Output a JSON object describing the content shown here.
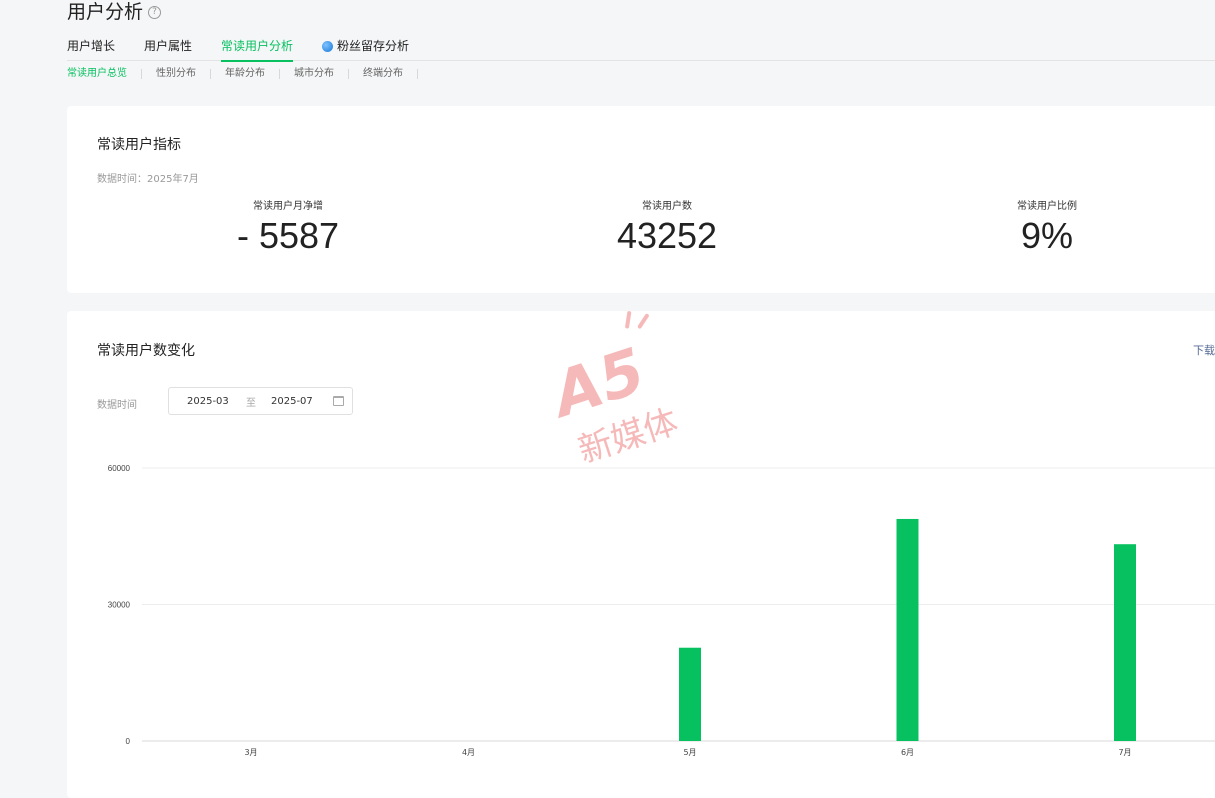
{
  "header": {
    "title": "用户分析",
    "help_icon": "question-circle-icon"
  },
  "tabs": [
    {
      "label": "用户增长",
      "active": false
    },
    {
      "label": "用户属性",
      "active": false
    },
    {
      "label": "常读用户分析",
      "active": true
    },
    {
      "label": "粉丝留存分析",
      "active": false,
      "icon": "fan-retention-icon"
    }
  ],
  "subtabs": [
    {
      "label": "常读用户总览",
      "active": true
    },
    {
      "label": "性别分布",
      "active": false
    },
    {
      "label": "年龄分布",
      "active": false
    },
    {
      "label": "城市分布",
      "active": false
    },
    {
      "label": "终端分布",
      "active": false
    }
  ],
  "metrics_card": {
    "title": "常读用户指标",
    "data_time": "数据时间：2025年7月",
    "metrics": [
      {
        "label": "常读用户月净增",
        "value": "- 5587"
      },
      {
        "label": "常读用户数",
        "value": "43252"
      },
      {
        "label": "常读用户比例",
        "value": "9%"
      }
    ]
  },
  "trend_card": {
    "title": "常读用户数变化",
    "download_label": "下载",
    "data_time_label": "数据时间",
    "date_start": "2025-03",
    "date_to": "至",
    "date_end": "2025-07"
  },
  "watermark": {
    "text": "新媒体",
    "logo": "A5"
  },
  "colors": {
    "accent": "#07c160",
    "link": "#576b95"
  },
  "chart_data": {
    "type": "bar",
    "categories": [
      "3月",
      "4月",
      "5月",
      "6月",
      "7月"
    ],
    "values": [
      0,
      0,
      20500,
      48800,
      43252
    ],
    "yticks": [
      "0",
      "30000",
      "60000"
    ],
    "ylim": [
      0,
      60000
    ],
    "grid": true
  }
}
